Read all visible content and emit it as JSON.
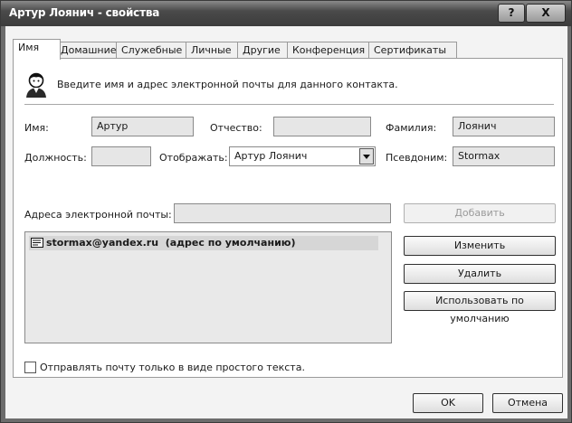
{
  "window": {
    "title": "Артур Лоянич - свойства",
    "help_label": "?",
    "close_label": "X"
  },
  "tabs": [
    {
      "label": "Имя",
      "active": true
    },
    {
      "label": "Домашние",
      "active": false
    },
    {
      "label": "Служебные",
      "active": false
    },
    {
      "label": "Личные",
      "active": false
    },
    {
      "label": "Другие",
      "active": false
    },
    {
      "label": "Конференция",
      "active": false
    },
    {
      "label": "Сертификаты",
      "active": false
    }
  ],
  "intro": {
    "text": "Введите имя и адрес электронной почты для данного контакта.",
    "icon": "contact-person-icon"
  },
  "name_fields": {
    "first_label": "Имя:",
    "first_value": "Артур",
    "middle_label": "Отчество:",
    "middle_value": "",
    "last_label": "Фамилия:",
    "last_value": "Лоянич",
    "position_label": "Должность:",
    "position_value": "",
    "display_label": "Отображать:",
    "display_value": "Артур Лоянич",
    "nickname_label": "Псевдоним:",
    "nickname_value": "Stormax"
  },
  "email": {
    "label": "Адреса электронной почты:",
    "input_value": "",
    "add_button": "Добавить",
    "edit_button": "Изменить",
    "delete_button": "Удалить",
    "default_button": "Использовать по умолчанию",
    "addresses": [
      "stormax@yandex.ru  (адрес по умолчанию)"
    ]
  },
  "plain_text": {
    "label": "Отправлять почту только в виде простого текста.",
    "checked": false
  },
  "footer": {
    "ok": "OK",
    "cancel": "Отмена"
  }
}
